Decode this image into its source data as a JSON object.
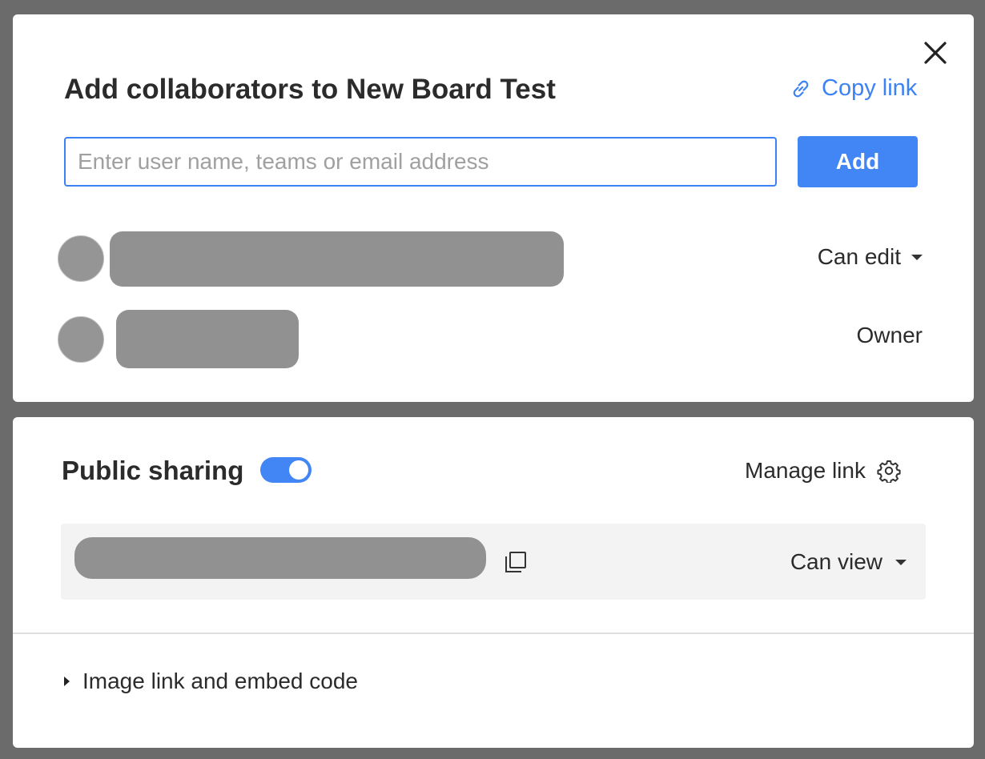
{
  "dialog": {
    "title": "Add collaborators to New Board Test",
    "copy_link_label": "Copy link",
    "close_icon": "close-icon"
  },
  "invite": {
    "placeholder": "Enter user name, teams or email address",
    "value": "",
    "add_label": "Add"
  },
  "collaborators": [
    {
      "name": "",
      "role": "Can edit",
      "role_has_dropdown": true
    },
    {
      "name": "",
      "role": "Owner",
      "role_has_dropdown": false
    }
  ],
  "public_sharing": {
    "label": "Public sharing",
    "enabled": true,
    "manage_link_label": "Manage link",
    "link_value": "",
    "permission": "Can view"
  },
  "embed": {
    "label": "Image link and embed code"
  },
  "colors": {
    "accent": "#4285f4",
    "link": "#3d82f4",
    "overlay": "#6b6b6b",
    "redaction": "#919191"
  }
}
